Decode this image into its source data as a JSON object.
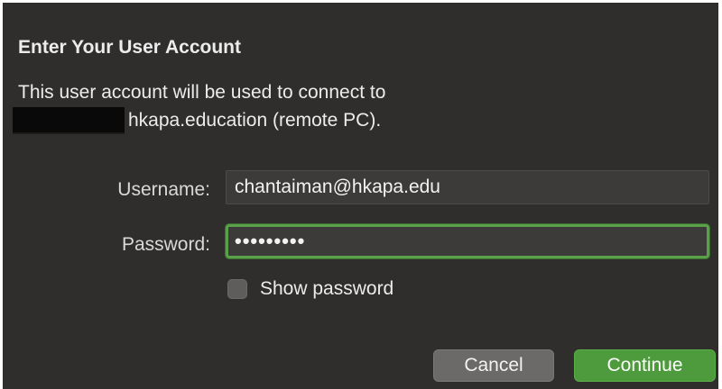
{
  "dialog": {
    "title": "Enter Your User Account",
    "description_line1": "This user account will be used to connect to",
    "description_line2": "hkapa.education (remote PC).",
    "redaction": "redacted-text"
  },
  "form": {
    "username_label": "Username:",
    "username_value": "chantaiman@hkapa.edu",
    "password_label": "Password:",
    "password_value": "•••••••••",
    "password_focused": true,
    "show_password_label": "Show password",
    "show_password_checked": false
  },
  "buttons": {
    "cancel_label": "Cancel",
    "continue_label": "Continue"
  },
  "colors": {
    "background": "#2f2e2d",
    "focus_ring": "#5aa04a",
    "primary_button": "#4e9b3d",
    "secondary_button": "#6b6a69"
  }
}
